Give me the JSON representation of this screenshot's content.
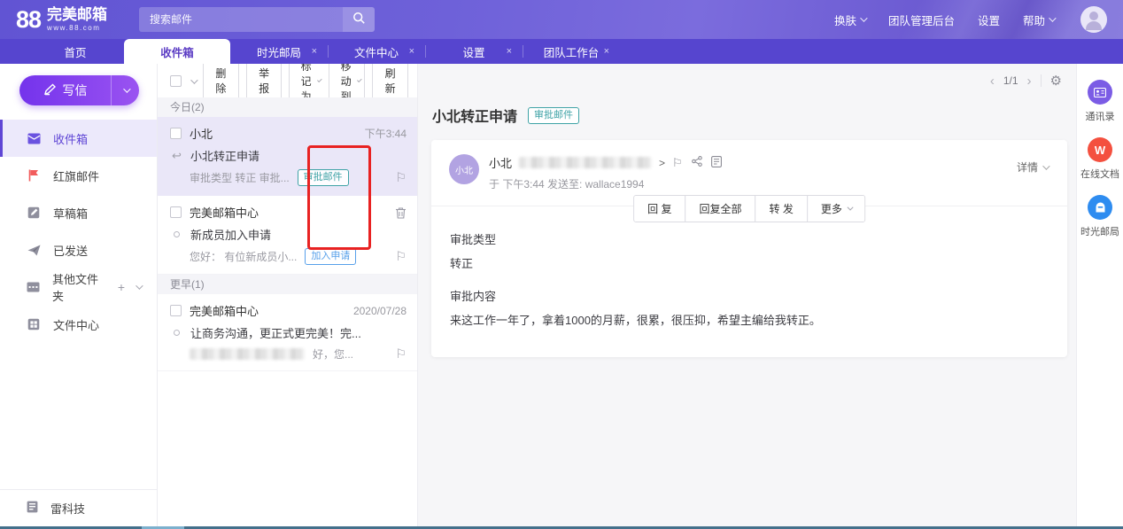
{
  "icons": {
    "close": "×",
    "prev": "‹",
    "next": ">",
    "prev_glyph": "‹",
    "next_glyph": "›",
    "gear": "⚙",
    "flag": "⚐",
    "reply": "↩",
    "plus": "+",
    "sender_arrow": ">",
    "docs_glyph": "W"
  },
  "header": {
    "logo": {
      "number": "88",
      "name": "完美邮箱",
      "domain": "www.88.com"
    },
    "search": {
      "placeholder": "搜索邮件"
    },
    "links": [
      {
        "label": "换肤"
      },
      {
        "label": "团队管理后台"
      },
      {
        "label": "设置"
      },
      {
        "label": "帮助"
      }
    ]
  },
  "tabs": [
    {
      "label": "首页"
    },
    {
      "label": "收件箱"
    },
    {
      "label": "时光邮局"
    },
    {
      "label": "文件中心"
    },
    {
      "label": "设置"
    },
    {
      "label": "团队工作台"
    }
  ],
  "sidebar": {
    "compose_label": "写信",
    "items": [
      {
        "label": "收件箱"
      },
      {
        "label": "红旗邮件"
      },
      {
        "label": "草稿箱"
      },
      {
        "label": "已发送"
      },
      {
        "label": "其他文件夹"
      },
      {
        "label": "文件中心"
      }
    ],
    "footer_item": "雷科技"
  },
  "list": {
    "toolbar": {
      "delete": "删 除",
      "report": "举 报",
      "mark": "标记为",
      "move": "移动到",
      "refresh": "刷 新"
    },
    "pagination": {
      "page": "1/1"
    },
    "sections": [
      {
        "title": "今日(2)",
        "emails": [
          {
            "sender": "小北",
            "time": "下午3:44",
            "subject": "小北转正申请",
            "preview": "审批类型 转正 审批...",
            "tag": "审批邮件"
          },
          {
            "sender": "完美邮箱中心",
            "subject": "新成员加入申请",
            "preview": "您好： 有位新成员小...",
            "tag": "加入申请"
          }
        ]
      },
      {
        "title": "更早(1)",
        "emails": [
          {
            "sender": "完美邮箱中心",
            "time": "2020/07/28",
            "subject": "让商务沟通，更正式更完美！完...",
            "preview": "好，您..."
          }
        ]
      }
    ]
  },
  "reader": {
    "subject": "小北转正申请",
    "badge": "审批邮件",
    "sender": {
      "name": "小北",
      "avatar_text": "小北",
      "meta": "于 下午3:44 发送至: wallace1994"
    },
    "details_label": "详情",
    "actions": {
      "reply": "回 复",
      "reply_all": "回复全部",
      "forward": "转 发",
      "more": "更多"
    },
    "body": {
      "label1": "审批类型",
      "value1": "转正",
      "label2": "审批内容",
      "value2": "来这工作一年了，拿着1000的月薪，很累，很压抑，希望主编给我转正。"
    }
  },
  "rightbar": {
    "items": [
      {
        "label": "通讯录"
      },
      {
        "label": "在线文档"
      },
      {
        "label": "时光邮局"
      }
    ]
  },
  "colors": {
    "accent_purple": "#5f46d5",
    "tag_teal": "#3fa3a6",
    "tag_blue": "#57a0ea",
    "annotation_red": "#e82222",
    "header_purple": "#6e61d9"
  }
}
